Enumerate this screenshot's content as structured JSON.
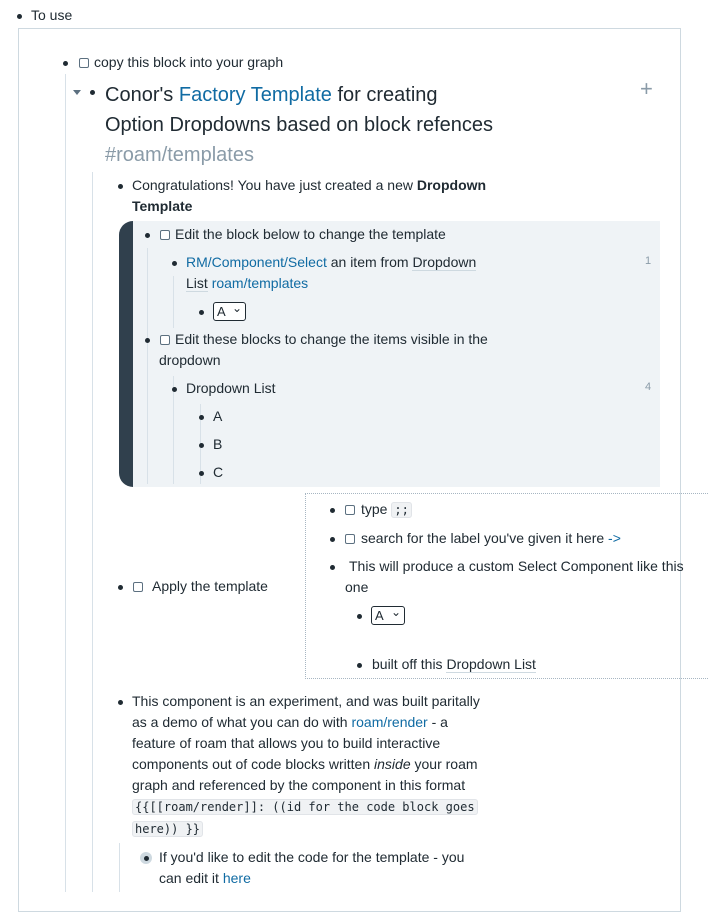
{
  "root": {
    "label": "To use"
  },
  "copy_block": {
    "label": "copy this block into your graph"
  },
  "header": {
    "prefix": "Conor's",
    "link": "Factory Template",
    "suffix": "for creating",
    "line2": "Option Dropdowns based on block refences",
    "tag": "#roam/templates",
    "plus": "+"
  },
  "congrats": {
    "text": "Congratulations! You have just created a new",
    "bold1": "Dropdown",
    "bold2": "Template"
  },
  "edit_below": {
    "label": "Edit the block below to change the template"
  },
  "component_line": {
    "link": "RM/Component/Select",
    "middle": "an item from",
    "ref1": "Dropdown",
    "ref2": "List",
    "link2": "roam/templates",
    "count": "1"
  },
  "select1": {
    "value": "A",
    "arrow": "⌄"
  },
  "edit_these": {
    "line1": "Edit these blocks to change the items visible in the",
    "line2": "dropdown"
  },
  "dropdown_list": {
    "label": "Dropdown List",
    "count": "4",
    "items": [
      "A",
      "B",
      "C"
    ]
  },
  "apply": {
    "label": "Apply the template"
  },
  "steps": {
    "type_label": "type",
    "type_code": ";;",
    "search_label": "search for the label you've given it here",
    "search_arrow": "->",
    "produce_line1": "This will produce a custom Select Component like this",
    "produce_line2": "one",
    "select_value": "A",
    "built_prefix": "built off this",
    "built_ref": "Dropdown List"
  },
  "experiment": {
    "l1": "This component is an experiment, and was built paritally",
    "l2a": "as a demo of what you can do with",
    "l2link": "roam/render",
    "l2b": "- a",
    "l3": "feature of roam that allows you to build interactive",
    "l4a": "components out of code blocks written",
    "l4i": "inside",
    "l4b": "your roam",
    "l5": "graph and referenced by the component in this format",
    "code1": "{{[[roam/render]]: ((id for the code block goes",
    "code2": "here)) }}"
  },
  "edit_code": {
    "l1": "If you'd like to edit the code for the template - you",
    "l2a": "can edit it",
    "l2link": "here"
  }
}
